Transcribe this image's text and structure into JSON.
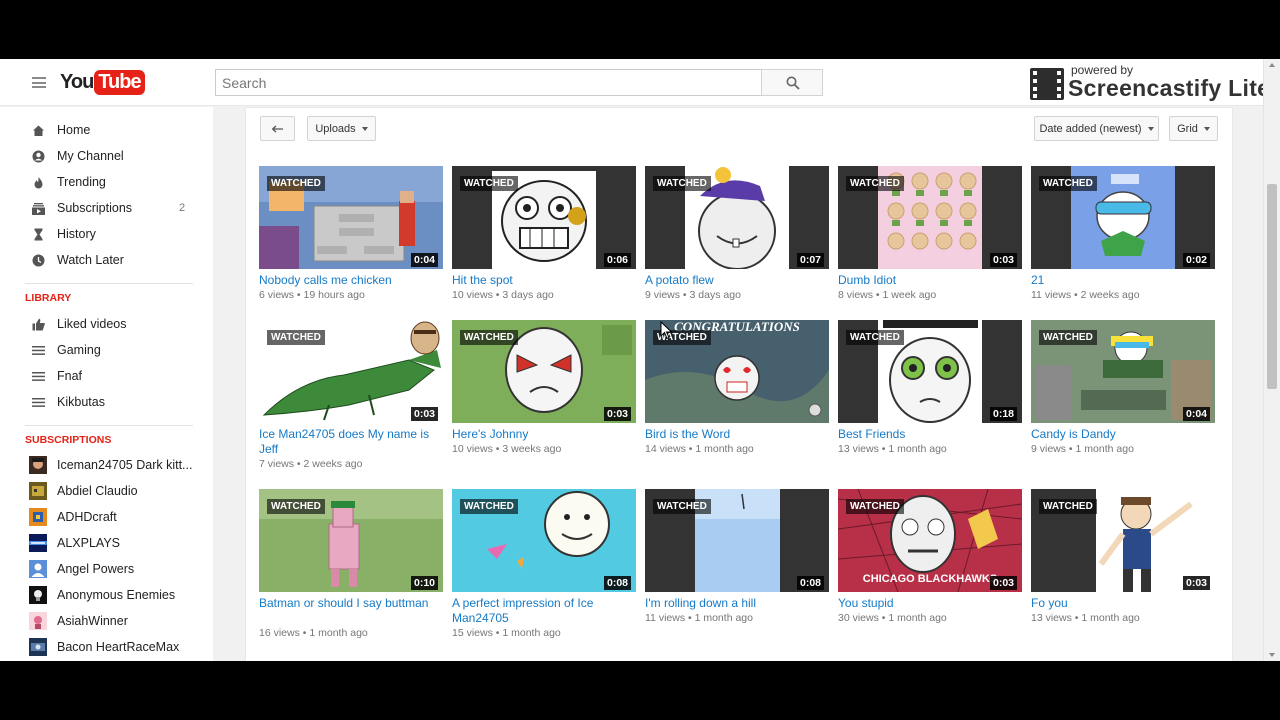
{
  "header": {
    "logo_you": "You",
    "logo_tube": "Tube",
    "search_placeholder": "Search"
  },
  "watermark": {
    "powered_by": "powered by",
    "brand": "Screencastify Lite"
  },
  "sidebar": {
    "main": [
      {
        "label": "Home",
        "icon": "home-icon"
      },
      {
        "label": "My Channel",
        "icon": "person-icon"
      },
      {
        "label": "Trending",
        "icon": "flame-icon"
      },
      {
        "label": "Subscriptions",
        "icon": "subscriptions-icon",
        "count": "2"
      },
      {
        "label": "History",
        "icon": "hourglass-icon"
      },
      {
        "label": "Watch Later",
        "icon": "clock-icon"
      }
    ],
    "library_heading": "LIBRARY",
    "library": [
      {
        "label": "Liked videos",
        "icon": "thumbs-up-icon"
      },
      {
        "label": "Gaming",
        "icon": "list-icon"
      },
      {
        "label": "Fnaf",
        "icon": "list-icon"
      },
      {
        "label": "Kikbutas",
        "icon": "list-icon"
      }
    ],
    "subscriptions_heading": "SUBSCRIPTIONS",
    "subscriptions": [
      {
        "label": "Iceman24705 Dark kitt..."
      },
      {
        "label": "Abdiel Claudio"
      },
      {
        "label": "ADHDcraft"
      },
      {
        "label": "ALXPLAYS"
      },
      {
        "label": "Angel Powers"
      },
      {
        "label": "Anonymous Enemies"
      },
      {
        "label": "AsiahWinner"
      },
      {
        "label": "Bacon HeartRaceMax"
      }
    ]
  },
  "toolbar": {
    "back_icon": "back-arrow-icon",
    "uploads_label": "Uploads",
    "sort_label": "Date added (newest)",
    "view_label": "Grid"
  },
  "watched_label": "WATCHED",
  "videos": [
    {
      "title": "Nobody calls me chicken",
      "views": "6 views",
      "age": "19 hours ago",
      "duration": "0:04"
    },
    {
      "title": "Hit the spot",
      "views": "10 views",
      "age": "3 days ago",
      "duration": "0:06"
    },
    {
      "title": "A potato flew",
      "views": "9 views",
      "age": "3 days ago",
      "duration": "0:07"
    },
    {
      "title": "Dumb Idiot",
      "views": "8 views",
      "age": "1 week ago",
      "duration": "0:03"
    },
    {
      "title": "21",
      "views": "11 views",
      "age": "2 weeks ago",
      "duration": "0:02"
    },
    {
      "title": "Ice Man24705 does My name is Jeff",
      "views": "7 views",
      "age": "2 weeks ago",
      "duration": "0:03"
    },
    {
      "title": "Here's Johnny",
      "views": "10 views",
      "age": "3 weeks ago",
      "duration": "0:03"
    },
    {
      "title": "Bird is the Word",
      "views": "14 views",
      "age": "1 month ago",
      "duration": ""
    },
    {
      "title": "Best Friends",
      "views": "13 views",
      "age": "1 month ago",
      "duration": "0:18"
    },
    {
      "title": "Candy is Dandy",
      "views": "9 views",
      "age": "1 month ago",
      "duration": "0:04"
    },
    {
      "title": "Batman or should I say buttman",
      "views": "16 views",
      "age": "1 month ago",
      "duration": "0:10"
    },
    {
      "title": "A perfect impression of Ice Man24705",
      "views": "15 views",
      "age": "1 month ago",
      "duration": "0:08"
    },
    {
      "title": "I'm rolling down a hill",
      "views": "11 views",
      "age": "1 month ago",
      "duration": "0:08"
    },
    {
      "title": "You stupid",
      "views": "30 views",
      "age": "1 month ago",
      "duration": "0:03"
    },
    {
      "title": "Fo you",
      "views": "13 views",
      "age": "1 month ago",
      "duration": "0:03"
    }
  ],
  "thumb_text": {
    "congrats": "CONGRATULATIONS",
    "chicago": "CHICAGO BLACKHAWKS"
  },
  "colors": {
    "brand_red": "#e62117",
    "link_blue": "#167ac6"
  }
}
